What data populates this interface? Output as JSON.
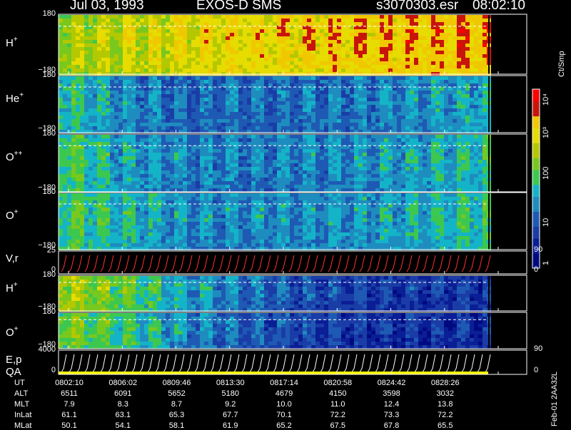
{
  "header": {
    "date": "Jul 03, 1993",
    "instrument": "EXOS-D SMS",
    "file": "s3070303.esr",
    "time": "08:02:10"
  },
  "footer": "Feb-01 2AA32L",
  "colorbar": {
    "unit": "Ct/Smp",
    "ticks": [
      "1",
      "10",
      "100",
      "10³",
      "10⁴"
    ]
  },
  "panels": [
    {
      "id": "h-plus-1",
      "species": "H",
      "charge": "+",
      "ymax": "180",
      "ymin": "−180",
      "kind": "spectrogram"
    },
    {
      "id": "he-plus",
      "species": "He",
      "charge": "+",
      "ymax": "180",
      "ymin": "−180",
      "kind": "spectrogram"
    },
    {
      "id": "o-plusplus",
      "species": "O",
      "charge": "++",
      "ymax": "180",
      "ymin": "−180",
      "kind": "spectrogram"
    },
    {
      "id": "o-plus-1",
      "species": "O",
      "charge": "+",
      "ymax": "180",
      "ymin": "−180",
      "kind": "spectrogram"
    },
    {
      "id": "v-r",
      "species": "V,r",
      "charge": "",
      "ymax": "25",
      "ymin": "0",
      "right_top": "90",
      "right_bottom": "0",
      "kind": "line"
    },
    {
      "id": "h-plus-2",
      "species": "H",
      "charge": "+",
      "ymax": "180",
      "ymin": "−180",
      "kind": "spectrogram"
    },
    {
      "id": "o-plus-2",
      "species": "O",
      "charge": "+",
      "ymax": "180",
      "ymin": "−180",
      "kind": "spectrogram"
    },
    {
      "id": "e-p-qa",
      "species": "E,p",
      "species2": "QA",
      "charge": "",
      "ymax": "4000",
      "ymin": "0",
      "right_top": "90",
      "right_bottom": "0",
      "kind": "line"
    }
  ],
  "ephemeris": {
    "labels": [
      "UT",
      "ALT",
      "MLT",
      "InLat",
      "MLat"
    ],
    "columns": [
      [
        "0802:10",
        "6511",
        "7.9",
        "61.1",
        "50.1"
      ],
      [
        "0806:02",
        "6091",
        "8.3",
        "63.1",
        "54.1"
      ],
      [
        "0809:46",
        "5652",
        "8.7",
        "65.3",
        "58.1"
      ],
      [
        "0813:30",
        "5180",
        "9.2",
        "67.7",
        "61.9"
      ],
      [
        "0817:14",
        "4679",
        "10.0",
        "70.1",
        "65.2"
      ],
      [
        "0820:58",
        "4150",
        "11.0",
        "72.2",
        "67.5"
      ],
      [
        "0824:42",
        "3598",
        "12.4",
        "73.3",
        "67.8"
      ],
      [
        "0828:26",
        "3032",
        "13.8",
        "72.2",
        "65.5"
      ]
    ]
  },
  "chart_data": {
    "type": "heatmap",
    "title": "Jul 03, 1993   EXOS-D SMS",
    "x": [
      "0802:10",
      "0806:02",
      "0809:46",
      "0813:30",
      "0817:14",
      "0820:58",
      "0824:42",
      "0828:26"
    ],
    "series": [
      {
        "name": "H+",
        "ylim": [
          -180,
          180
        ],
        "intensity": [
          0.55,
          0.6,
          0.65,
          0.68,
          0.7,
          0.72,
          0.74,
          0.75
        ]
      },
      {
        "name": "He+",
        "ylim": [
          -180,
          180
        ],
        "intensity": [
          0.4,
          0.28,
          0.22,
          0.22,
          0.23,
          0.25,
          0.3,
          0.34
        ]
      },
      {
        "name": "O++",
        "ylim": [
          -180,
          180
        ],
        "intensity": [
          0.45,
          0.32,
          0.26,
          0.25,
          0.26,
          0.28,
          0.33,
          0.38
        ]
      },
      {
        "name": "O+",
        "ylim": [
          -180,
          180
        ],
        "intensity": [
          0.45,
          0.36,
          0.28,
          0.27,
          0.28,
          0.3,
          0.35,
          0.4
        ]
      },
      {
        "name": "V,r",
        "ylim": [
          0,
          25
        ]
      },
      {
        "name": "H+",
        "ylim": [
          -180,
          180
        ],
        "intensity": [
          0.58,
          0.48,
          0.32,
          0.24,
          0.16,
          0.12,
          0.1,
          0.1
        ]
      },
      {
        "name": "O+",
        "ylim": [
          -180,
          180
        ],
        "intensity": [
          0.5,
          0.42,
          0.28,
          0.2,
          0.14,
          0.1,
          0.08,
          0.08
        ]
      },
      {
        "name": "E,p",
        "ylim": [
          0,
          4000
        ]
      }
    ],
    "colorscale": {
      "min": 1,
      "max": 10000,
      "scale": "log",
      "ticks": [
        1,
        10,
        100,
        1000,
        10000
      ]
    }
  }
}
